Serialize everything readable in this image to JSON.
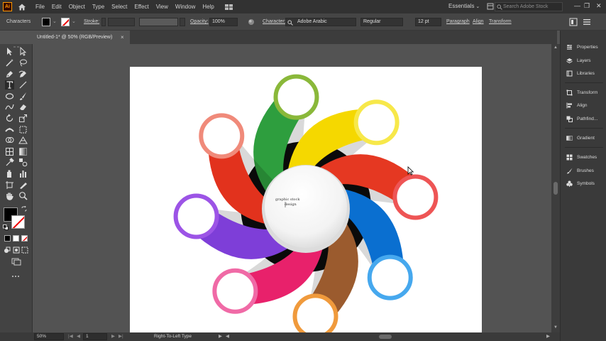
{
  "app": {
    "logo": "Ai"
  },
  "menu": [
    "File",
    "Edit",
    "Object",
    "Type",
    "Select",
    "Effect",
    "View",
    "Window",
    "Help"
  ],
  "workspace": "Essentials",
  "search": {
    "placeholder": "Search Adobe Stock"
  },
  "control_bar": {
    "selection_label": "Characters",
    "stroke_label": "Stroke:",
    "opacity_label": "Opacity:",
    "opacity_value": "100%",
    "character_label": "Character:",
    "font_family": "Adobe Arabic",
    "font_style": "Regular",
    "font_size": "12 pt",
    "paragraph_label": "Paragraph",
    "align_label": "Align",
    "transform_label": "Transform"
  },
  "document_tab": {
    "title": "Untitled-1* @ 50% (RGB/Preview)",
    "close": "×"
  },
  "canvas": {
    "text_line1": "graphic stock",
    "text_line2": "design",
    "petal_colors": [
      "#2e9e3e",
      "#f5d800",
      "#e53822",
      "#0a6fd0",
      "#9b5b2e",
      "#e8216b",
      "#7e3ed8",
      "#e2321d"
    ],
    "ring_colors": [
      "#8ab83a",
      "#f7e84a",
      "#ee5555",
      "#46a8ee",
      "#f09a3c",
      "#f06aa6",
      "#9c54e6",
      "#f08a7a"
    ]
  },
  "right_panel": {
    "items": [
      "Properties",
      "Layers",
      "Libraries",
      "Transform",
      "Align",
      "Pathfind...",
      "Gradient",
      "Swatches",
      "Brushes",
      "Symbols"
    ]
  },
  "status_bar": {
    "zoom": "50%",
    "artboard_number": "1",
    "current_tool": "Right-To-Left Type"
  },
  "window_controls": {
    "minimize": "—",
    "maximize": "❐",
    "close": "✕"
  }
}
